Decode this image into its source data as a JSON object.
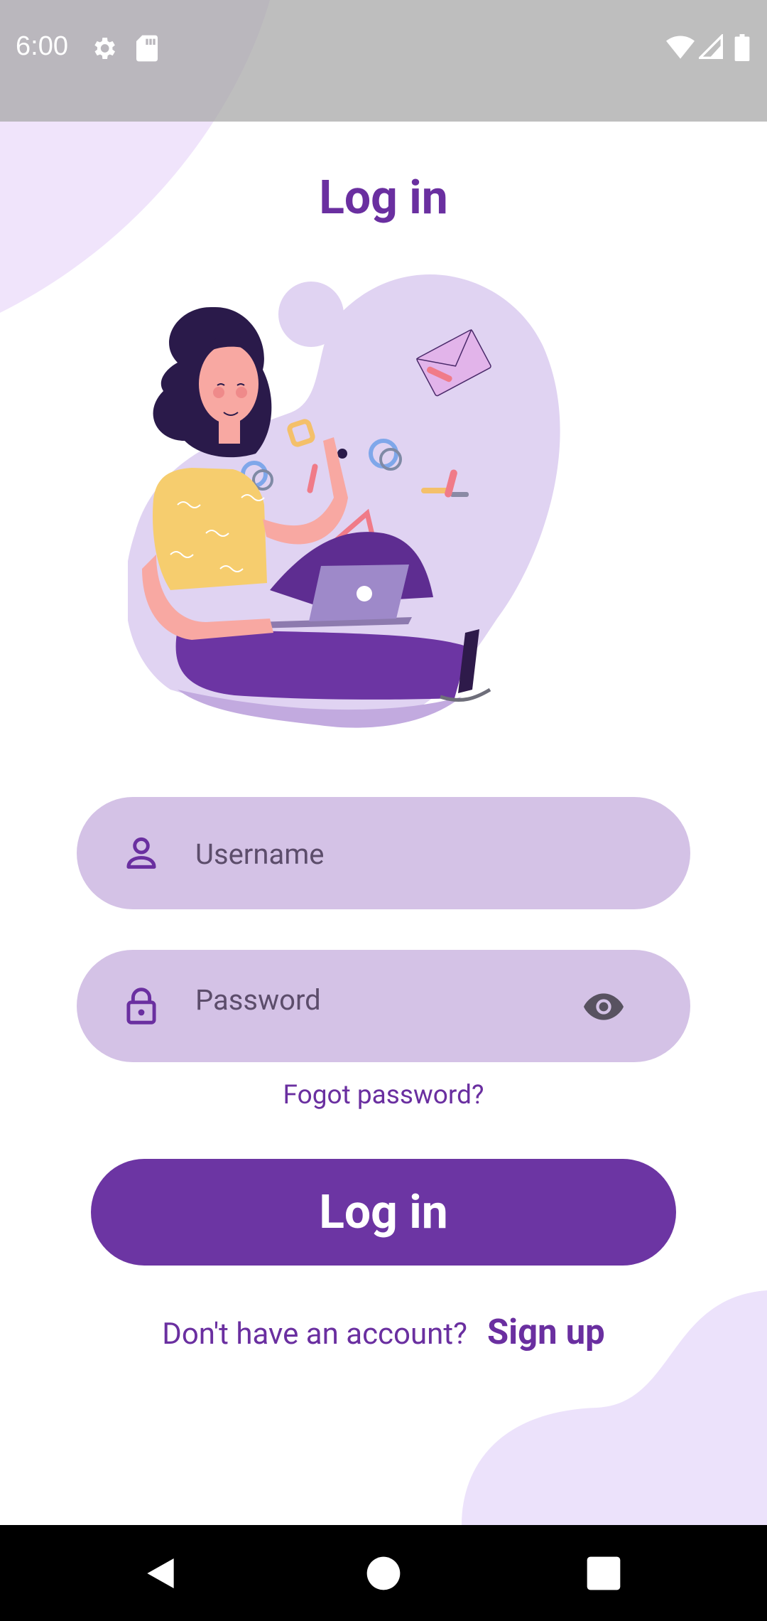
{
  "status_bar": {
    "time": "6:00",
    "icons": [
      "settings-icon",
      "sd-card-icon",
      "wifi-icon",
      "signal-icon",
      "battery-icon"
    ]
  },
  "login": {
    "title": "Log in",
    "username_placeholder": "Username",
    "password_placeholder": "Password",
    "forgot_password": "Fogot password?",
    "button_label": "Log in",
    "no_account_text": "Don't have an account?",
    "signup_link": "Sign up"
  },
  "nav_bar": {
    "buttons": [
      "back-icon",
      "home-icon",
      "recents-icon"
    ]
  },
  "colors": {
    "primary": "#6c35a3",
    "title": "#6a2fa0",
    "field_bg": "#d4c2e6",
    "blob": "#ece2fb",
    "illustration_bg": "#e0d3f2"
  }
}
